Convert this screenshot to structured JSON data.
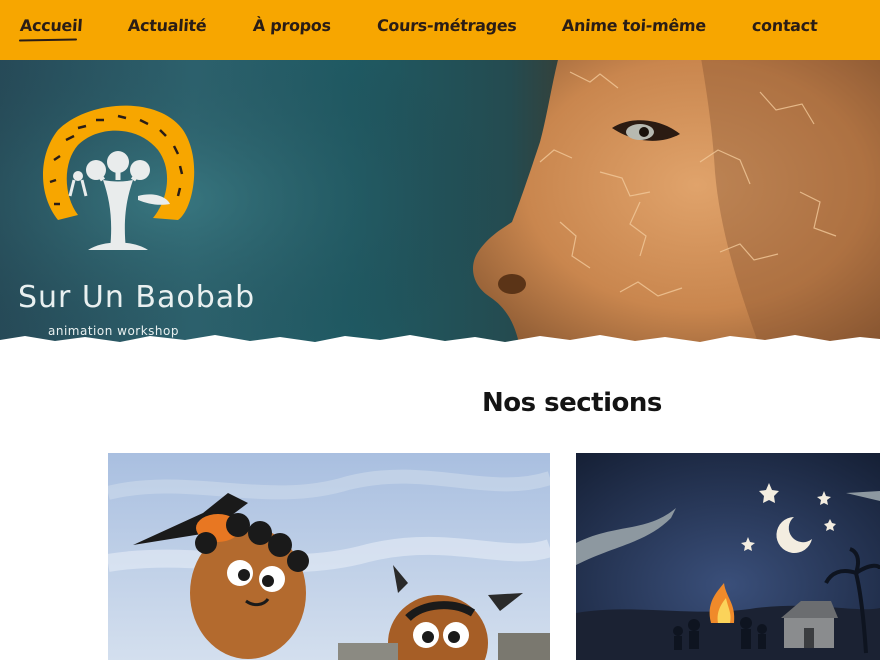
{
  "nav": {
    "items": [
      {
        "label": "Accueil",
        "active": true
      },
      {
        "label": "Actualité",
        "active": false
      },
      {
        "label": "À propos",
        "active": false
      },
      {
        "label": "Cours-métrages",
        "active": false
      },
      {
        "label": "Anime toi-même",
        "active": false
      },
      {
        "label": "contact",
        "active": false
      }
    ]
  },
  "brand": {
    "title": "Sur Un Baobab",
    "subtitle": "animation workshop"
  },
  "sections": {
    "title": "Nos sections"
  },
  "colors": {
    "accent": "#f7a600",
    "text": "#2a1d16"
  }
}
